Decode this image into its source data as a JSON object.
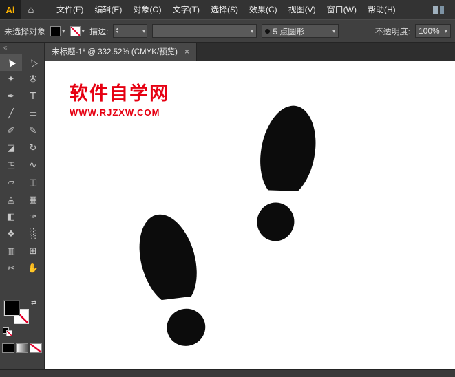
{
  "app": {
    "logo_text": "Ai"
  },
  "icons": {
    "home": "⌂",
    "chevron_down": "▾",
    "spinner_up": "▴",
    "spinner_down": "▾",
    "close": "×",
    "collapse": "«",
    "swap": "⇄"
  },
  "menu": [
    "文件(F)",
    "编辑(E)",
    "对象(O)",
    "文字(T)",
    "选择(S)",
    "效果(C)",
    "视图(V)",
    "窗口(W)",
    "帮助(H)"
  ],
  "control_bar": {
    "status": "未选择对象",
    "stroke_label": "描边:",
    "stroke_weight_value": "",
    "brush_value": "5 点圆形",
    "opacity_label": "不透明度:",
    "opacity_value": "100%"
  },
  "tab": {
    "title": "未标题-1* @ 332.52% (CMYK/预览)"
  },
  "canvas": {
    "watermark_title": "软件自学网",
    "watermark_url": "WWW.RJZXW.COM"
  },
  "tools": [
    {
      "name": "selection-tool",
      "glyph": "▲"
    },
    {
      "name": "direct-selection-tool",
      "glyph": "△"
    },
    {
      "name": "magic-wand-tool",
      "glyph": "✦"
    },
    {
      "name": "lasso-tool",
      "glyph": "✇"
    },
    {
      "name": "pen-tool",
      "glyph": "✒"
    },
    {
      "name": "type-tool",
      "glyph": "T"
    },
    {
      "name": "line-segment-tool",
      "glyph": "╱"
    },
    {
      "name": "rectangle-tool",
      "glyph": "▭"
    },
    {
      "name": "paintbrush-tool",
      "glyph": "✐"
    },
    {
      "name": "pencil-tool",
      "glyph": "✎"
    },
    {
      "name": "eraser-tool",
      "glyph": "◪"
    },
    {
      "name": "rotate-tool",
      "glyph": "↻"
    },
    {
      "name": "scale-tool",
      "glyph": "◳"
    },
    {
      "name": "width-tool",
      "glyph": "∿"
    },
    {
      "name": "free-transform-tool",
      "glyph": "▱"
    },
    {
      "name": "shape-builder-tool",
      "glyph": "◫"
    },
    {
      "name": "perspective-grid-tool",
      "glyph": "◬"
    },
    {
      "name": "mesh-tool",
      "glyph": "▦"
    },
    {
      "name": "gradient-tool",
      "glyph": "◧"
    },
    {
      "name": "eyedropper-tool",
      "glyph": "✑"
    },
    {
      "name": "blend-tool",
      "glyph": "❖"
    },
    {
      "name": "symbol-sprayer-tool",
      "glyph": "░"
    },
    {
      "name": "column-graph-tool",
      "glyph": "▥"
    },
    {
      "name": "artboard-tool",
      "glyph": "⊞"
    },
    {
      "name": "slice-tool",
      "glyph": "✂"
    },
    {
      "name": "hand-tool",
      "glyph": "✋"
    }
  ],
  "colors": {
    "watermark_red": "#e60012",
    "fill": "#000000",
    "stroke": "none",
    "ui_dark": "#3f3f3f"
  }
}
